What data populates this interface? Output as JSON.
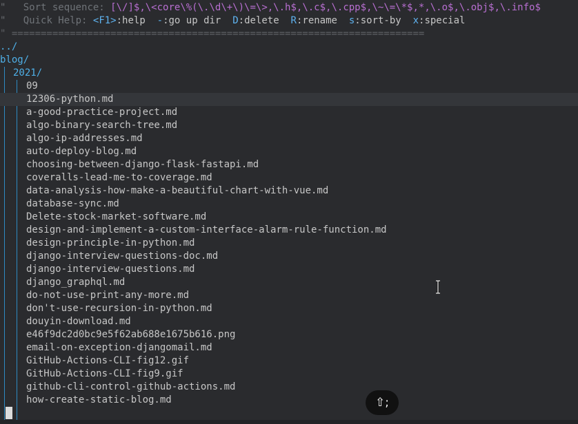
{
  "header": {
    "sort_marker": "\"",
    "sort_label": "Sort sequence: ",
    "sort_value": "[\\/]$,\\<core\\%(\\.\\d\\+\\)\\=\\>,\\.h$,\\.c$,\\.cpp$,\\~\\=\\*$,*,\\.o$,\\.obj$,\\.info$",
    "help_marker": "\"",
    "help_label": "Quick Help: ",
    "help_items": [
      {
        "key": "<F1>",
        "text": ":help"
      },
      {
        "key": "-",
        "text": ":go up dir"
      },
      {
        "key": "D",
        "text": ":delete"
      },
      {
        "key": "R",
        "text": ":rename"
      },
      {
        "key": "s",
        "text": ":sort-by"
      },
      {
        "key": "x",
        "text": ":special"
      }
    ],
    "separator": "\" ======================================================================="
  },
  "tree": {
    "parent": "../",
    "root": "blog/",
    "subdir": "2021/",
    "files": [
      "09",
      "12306-python.md",
      "a-good-practice-project.md",
      "algo-binary-search-tree.md",
      "algo-ip-addresses.md",
      "auto-deploy-blog.md",
      "choosing-between-django-flask-fastapi.md",
      "coveralls-lead-me-to-coverage.md",
      "data-analysis-how-make-a-beautiful-chart-with-vue.md",
      "database-sync.md",
      "Delete-stock-market-software.md",
      "design-and-implement-a-custom-interface-alarm-rule-function.md",
      "design-principle-in-python.md",
      "django-interview-questions-doc.md",
      "django-interview-questions.md",
      "django_graphql.md",
      "do-not-use-print-any-more.md",
      "don't-use-recursion-in-python.md",
      "douyin-download.md",
      "e46f9dc2d0bc9e5f62ab688e1675b616.png",
      "email-on-exception-djangomail.md",
      "GitHub-Actions-CLI-fig12.gif",
      "GitHub-Actions-CLI-fig9.gif",
      "github-cli-control-github-actions.md",
      "how-create-static-blog.md"
    ],
    "cursor_line_index": 1
  },
  "overlay": {
    "shortcut_badge": "⇧;"
  },
  "colors": {
    "background": "#2a2b2e",
    "directory": "#4fb0e8",
    "sort_pattern": "#b86fd1",
    "help_key": "#5fb3f0",
    "indent_guide": "#2e8cc4"
  }
}
